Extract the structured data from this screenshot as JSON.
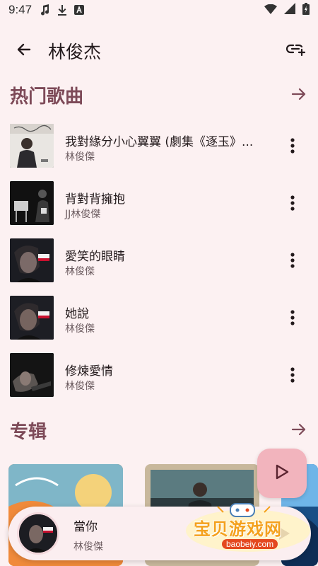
{
  "status": {
    "time": "9:47",
    "icons": [
      "music-note-icon",
      "download-icon",
      "font-a-icon"
    ],
    "right_icons": [
      "wifi-icon",
      "signal-icon",
      "battery-icon"
    ]
  },
  "header": {
    "title": "林俊杰",
    "back_icon": "arrow-left-icon",
    "share_icon": "playlist-add-icon"
  },
  "hot_songs": {
    "title": "热门歌曲",
    "songs": [
      {
        "title": "我對緣分小心翼翼 (劇集《逐玉》...",
        "artist": "林俊傑"
      },
      {
        "title": "背對背擁抱",
        "artist": "JJ林俊傑"
      },
      {
        "title": "愛笑的眼睛",
        "artist": "林俊傑"
      },
      {
        "title": "她說",
        "artist": "林俊傑"
      },
      {
        "title": "修煉愛情",
        "artist": "林俊傑"
      }
    ]
  },
  "albums": {
    "title": "专辑"
  },
  "player": {
    "title": "當你",
    "artist": "林俊傑"
  },
  "watermark": {
    "text": "宝贝游戏网",
    "url": "baobeiy.com"
  },
  "colors": {
    "background": "#fcf1f2",
    "section_title": "#7d4a58",
    "fab": "#f2b4bd",
    "accent": "#7d4a58"
  }
}
